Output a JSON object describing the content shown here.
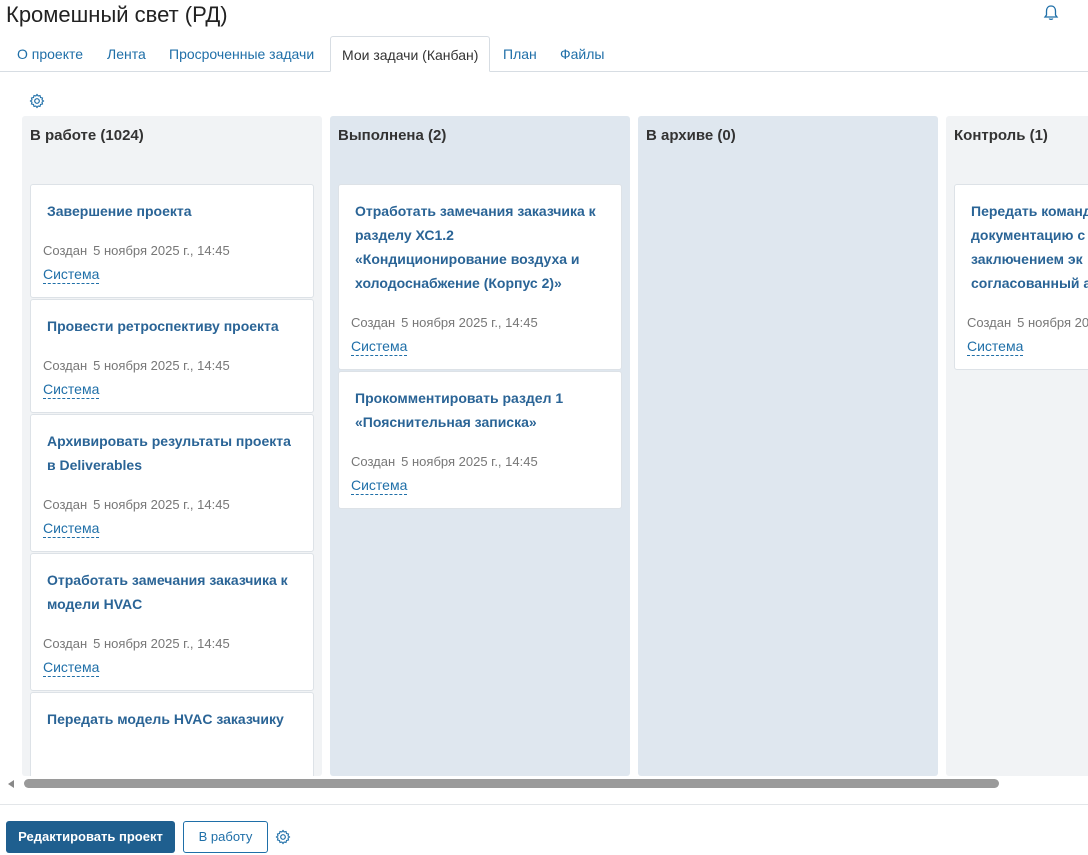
{
  "header": {
    "title": "Кромешный свет (РД)",
    "bell_icon": "bell-icon"
  },
  "tabs": [
    {
      "label": "О проекте"
    },
    {
      "label": "Лента"
    },
    {
      "label": "Просроченные задачи"
    },
    {
      "label": "Мои задачи (Канбан)"
    },
    {
      "label": "План"
    },
    {
      "label": "Файлы"
    }
  ],
  "board_settings_icon": "gear-icon",
  "columns": [
    {
      "title": "В работе (1024)",
      "cards": [
        {
          "title": "Завершение проекта",
          "created_label": "Создан",
          "created": "5 ноября 2025 г., 14:45",
          "author": "Система"
        },
        {
          "title": "Провести ретроспективу проекта",
          "created_label": "Создан",
          "created": "5 ноября 2025 г., 14:45",
          "author": "Система"
        },
        {
          "title": "Архивировать результаты проекта в Deliverables",
          "created_label": "Создан",
          "created": "5 ноября 2025 г., 14:45",
          "author": "Система"
        },
        {
          "title": "Отработать замечания заказчика к модели HVAC",
          "created_label": "Создан",
          "created": "5 ноября 2025 г., 14:45",
          "author": "Система"
        },
        {
          "title": "Передать модель HVAC заказчику"
        }
      ]
    },
    {
      "title": "Выполнена (2)",
      "cards": [
        {
          "title": "Отработать замечания заказчика к разделу ХС1.2 «Кондиционирование воздуха и холодоснабжение (Корпус 2)»",
          "created_label": "Создан",
          "created": "5 ноября 2025 г., 14:45",
          "author": "Система"
        },
        {
          "title": "Прокомментировать раздел 1 «Пояснительная записка»",
          "created_label": "Создан",
          "created": "5 ноября 2025 г., 14:45",
          "author": "Система"
        }
      ]
    },
    {
      "title": "В архиве (0)",
      "cards": []
    },
    {
      "title": "Контроль (1)",
      "cards": [
        {
          "title": "Передать команд документацию с заключением эк согласованный а",
          "created_label": "Создан",
          "created": "5 ноября 20",
          "author": "Система"
        }
      ]
    }
  ],
  "footer": {
    "edit_label": "Редактировать проект",
    "to_work_label": "В работу",
    "settings_icon": "gear-icon"
  }
}
